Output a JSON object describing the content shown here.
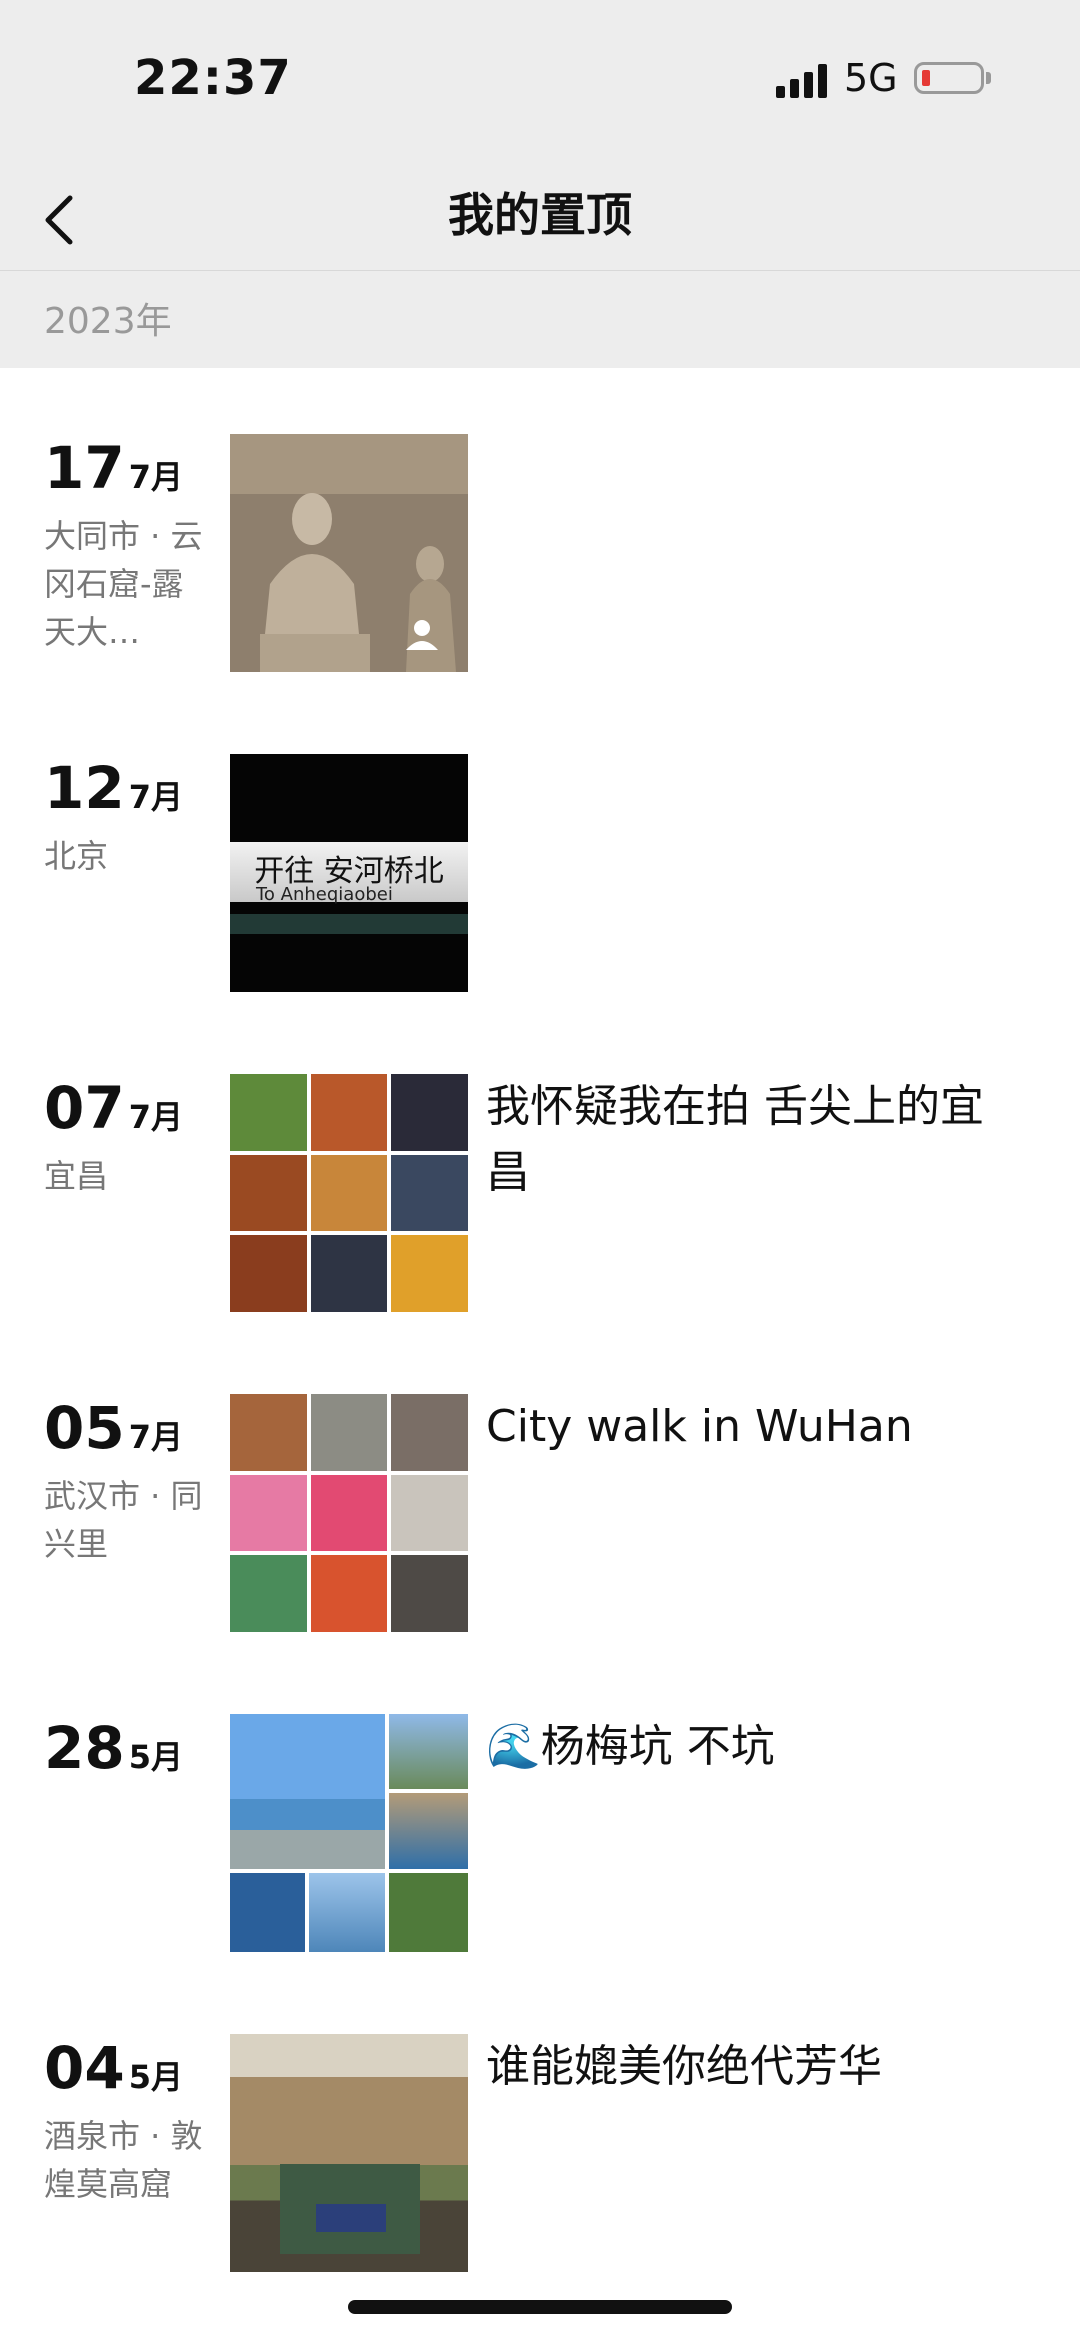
{
  "status": {
    "time": "22:37",
    "network": "5G"
  },
  "nav": {
    "title": "我的置顶"
  },
  "year": "2023年",
  "entries": [
    {
      "day": "17",
      "month": "7月",
      "location": "大同市 · 云冈石窟-露天大…",
      "caption": ""
    },
    {
      "day": "12",
      "month": "7月",
      "location": "北京",
      "caption": "",
      "photo_text": "开往 安河桥北",
      "photo_subtext": "To Anheqiaobei"
    },
    {
      "day": "07",
      "month": "7月",
      "location": "宜昌",
      "caption": "我怀疑我在拍 舌尖上的宜昌"
    },
    {
      "day": "05",
      "month": "7月",
      "location": "武汉市 · 同兴里",
      "caption": "City walk in WuHan"
    },
    {
      "day": "28",
      "month": "5月",
      "location": "",
      "caption": "🌊杨梅坑 不坑"
    },
    {
      "day": "04",
      "month": "5月",
      "location": "酒泉市 · 敦煌莫高窟",
      "caption": "谁能媲美你绝代芳华"
    }
  ]
}
